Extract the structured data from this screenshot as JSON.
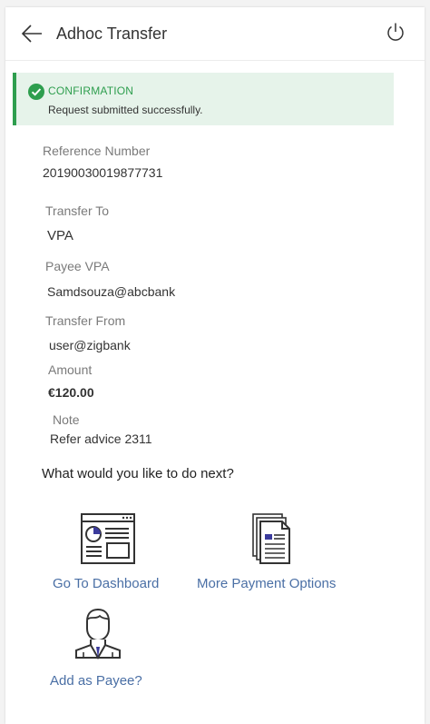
{
  "header": {
    "title": "Adhoc Transfer"
  },
  "confirmation": {
    "title": "CONFIRMATION",
    "message": "Request submitted successfully."
  },
  "details": {
    "reference": {
      "label": "Reference Number",
      "value": "20190030019877731"
    },
    "transfer_to": {
      "label": "Transfer To",
      "value": "VPA"
    },
    "payee_vpa": {
      "label": "Payee VPA",
      "value": "Samdsouza@abcbank"
    },
    "transfer_from": {
      "label": "Transfer From",
      "value": "user@zigbank"
    },
    "amount": {
      "label": "Amount",
      "value": "€120.00"
    },
    "note": {
      "label": "Note",
      "value": "Refer advice 2311"
    }
  },
  "next": {
    "question": "What would you like to do next?",
    "actions": [
      {
        "label": "Go To Dashboard",
        "icon": "dashboard-icon"
      },
      {
        "label": "More Payment Options",
        "icon": "document-icon"
      },
      {
        "label": "Add as Payee?",
        "icon": "person-icon"
      }
    ]
  },
  "colors": {
    "success": "#2e9e4e",
    "success_bg": "#e6f3ea",
    "link": "#4a6fa5",
    "icon_accent": "#3b3b9c"
  }
}
